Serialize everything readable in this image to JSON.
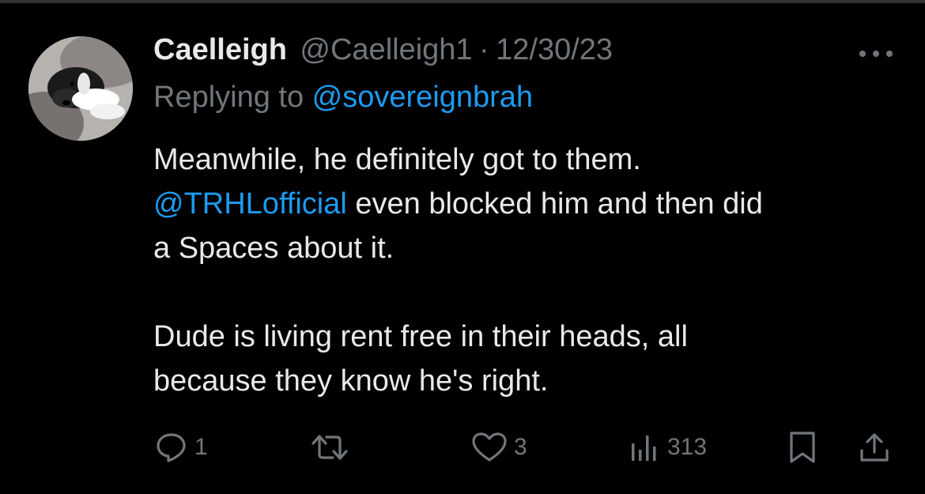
{
  "tweet": {
    "display_name": "Caelleigh",
    "handle": "@Caelleigh1",
    "separator": "·",
    "date": "12/30/23",
    "replying_prefix": "Replying to ",
    "replying_to": "@sovereignbrah",
    "body": {
      "line1": "Meanwhile, he definitely got to them.",
      "mention": "@TRHLofficial",
      "line2_rest": " even blocked him and then did",
      "line3": "a Spaces about it.",
      "paragraph2_line1": "Dude is living rent free in their heads, all",
      "paragraph2_line2": "because they know he's right."
    },
    "stats": {
      "replies": "1",
      "retweets": "",
      "likes": "3",
      "views": "313"
    },
    "icons": {
      "more": "more-horizontal-icon",
      "reply": "reply-icon",
      "retweet": "retweet-icon",
      "like": "heart-icon",
      "views": "views-chart-icon",
      "bookmark": "bookmark-icon",
      "share": "share-icon"
    },
    "colors": {
      "background": "#000000",
      "text": "#e7e9ea",
      "muted": "#71767b",
      "link": "#1d9bf0"
    }
  }
}
